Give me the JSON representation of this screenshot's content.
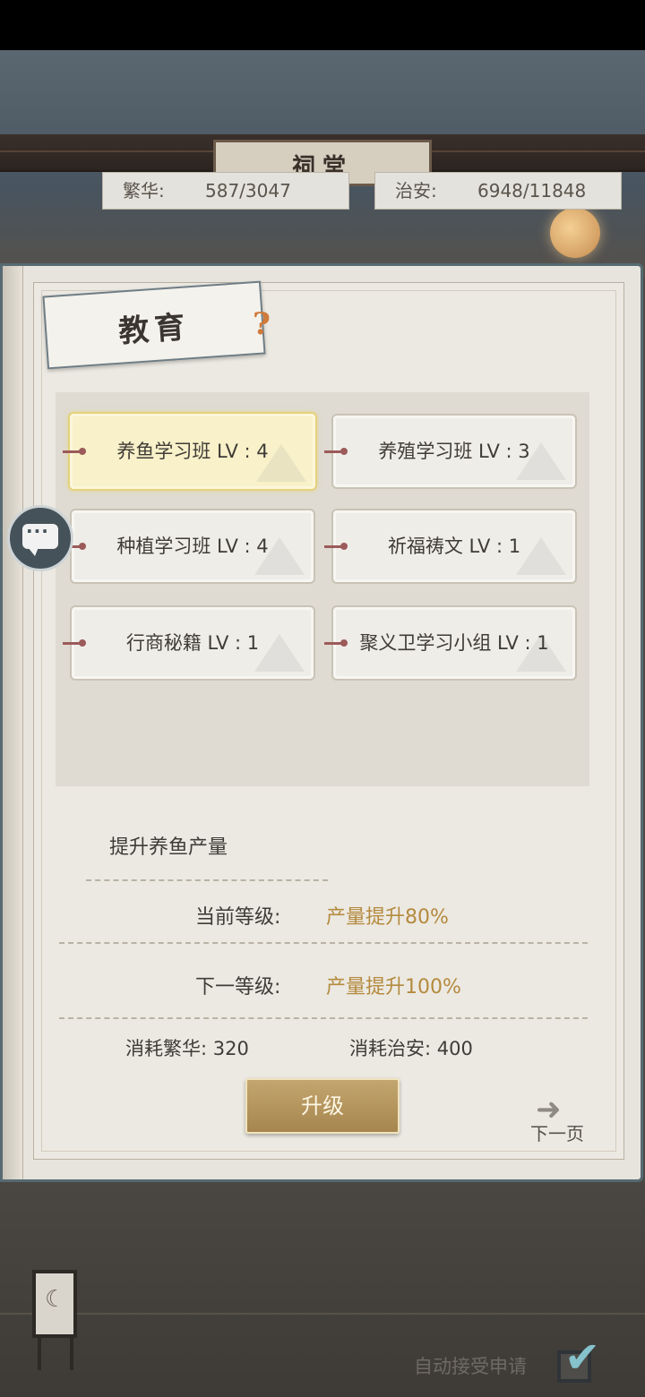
{
  "scene": {
    "building_sign": "祠堂"
  },
  "stats": {
    "prosperity_label": "繁华:",
    "prosperity_value": "587/3047",
    "security_label": "治安:",
    "security_value": "6948/11848"
  },
  "panel": {
    "title": "教育",
    "help_icon": "?"
  },
  "courses": [
    {
      "label": "养鱼学习班 LV : 4",
      "selected": true
    },
    {
      "label": "养殖学习班 LV : 3",
      "selected": false
    },
    {
      "label": "种植学习班 LV : 4",
      "selected": false
    },
    {
      "label": "祈福祷文 LV : 1",
      "selected": false
    },
    {
      "label": "行商秘籍 LV : 1",
      "selected": false
    },
    {
      "label": "聚义卫学习小组 LV : 1",
      "selected": false
    }
  ],
  "detail": {
    "description": "提升养鱼产量",
    "current_label": "当前等级:",
    "current_value": "产量提升80%",
    "next_label": "下一等级:",
    "next_value": "产量提升100%",
    "cost_prosperity": "消耗繁华: 320",
    "cost_security": "消耗治安: 400"
  },
  "buttons": {
    "upgrade": "升级",
    "next_page": "下一页"
  },
  "footer": {
    "auto_accept_label": "自动接受申请",
    "auto_accept_checked": true
  },
  "icons": {
    "chat": "chat-bubble-icon",
    "next_arrow": "arrow-right-icon",
    "lamp": "lamp-icon",
    "check": "checkmark-icon"
  },
  "colors": {
    "accent_gold": "#b48a3e",
    "button_gold": "#b99a60",
    "selected_highlight": "#f8f1c9",
    "check_blue": "#85c2cc"
  }
}
